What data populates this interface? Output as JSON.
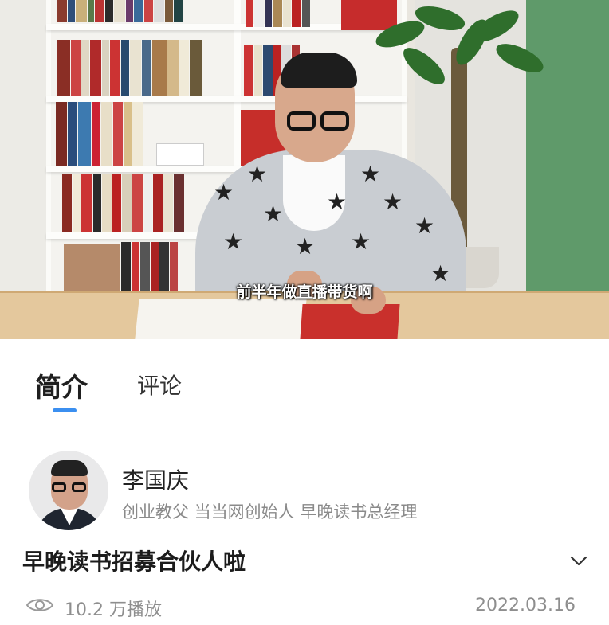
{
  "video": {
    "subtitle": "前半年做直播带货啊"
  },
  "tabs": [
    {
      "label": "简介",
      "active": true
    },
    {
      "label": "评论",
      "active": false
    }
  ],
  "author": {
    "name": "李国庆",
    "bio": "创业教父 当当网创始人 早晚读书总经理"
  },
  "post": {
    "title": "早晚读书招募合伙人啦",
    "plays": "10.2 万播放",
    "date": "2022.03.16"
  },
  "icons": {
    "views": "eye-icon",
    "expand": "chevron-down-icon"
  },
  "colors": {
    "accent": "#3b8ff0",
    "muted_text": "#8e8e8e"
  }
}
